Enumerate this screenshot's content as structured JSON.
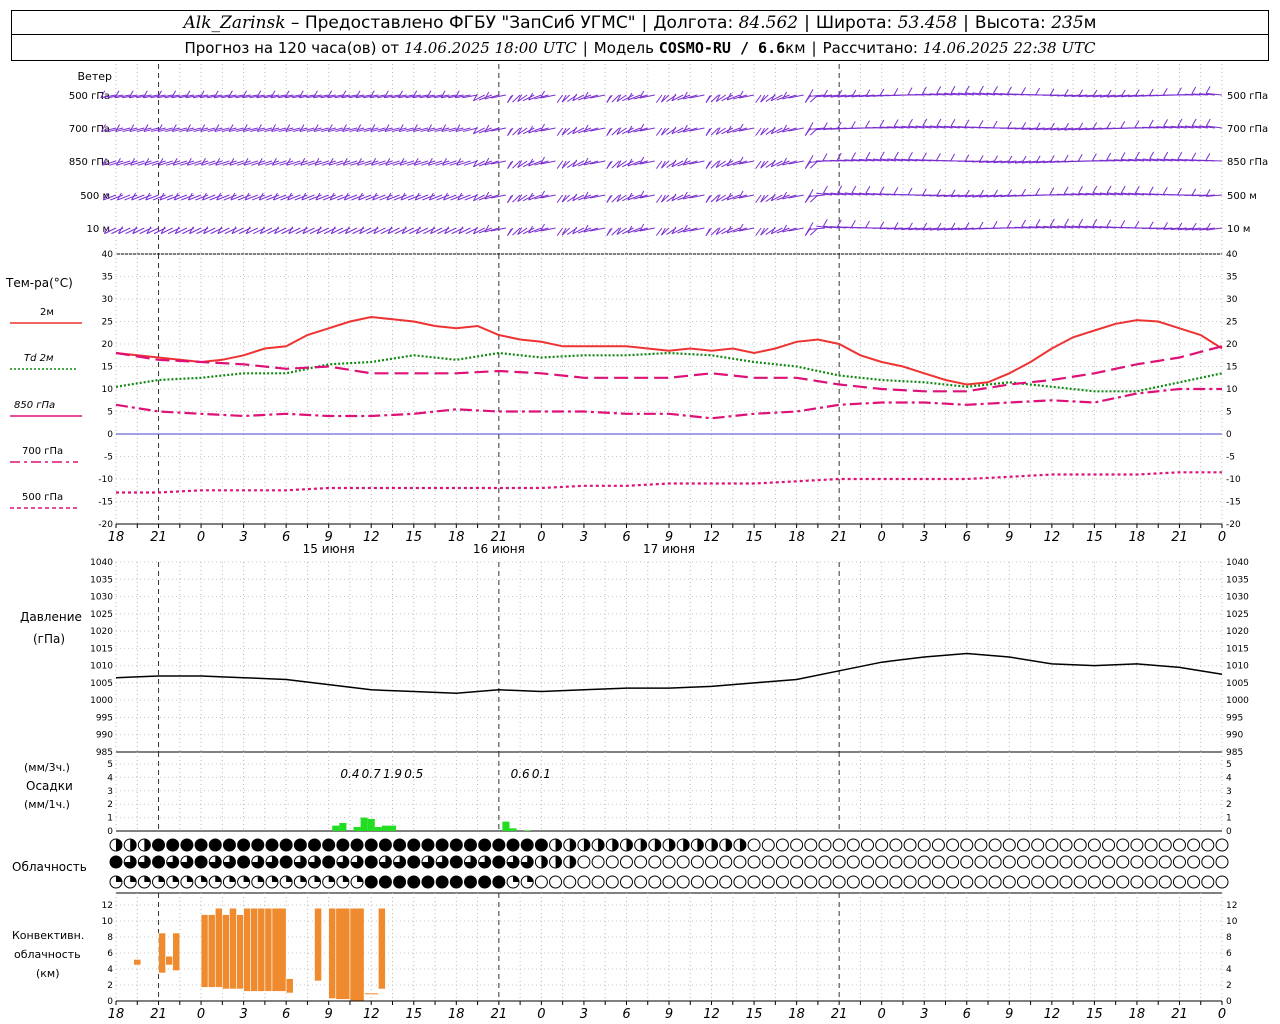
{
  "header": {
    "station": "Alk_Zarinsk",
    "provider": " – Предоставлено ФГБУ \"ЗапСиб УГМС\"",
    "lon_label": "Долгота:",
    "lon": "84.562",
    "lat_label": "Широта:",
    "lat": "53.458",
    "alt_label": "Высота:",
    "alt": "235",
    "alt_unit": "м",
    "forecast_label": "Прогноз на 120 часа(ов) от",
    "run_time": "14.06.2025 18:00 UTC",
    "model_label": "Модель",
    "model": "COSMO-RU / 6.6",
    "model_unit": "км",
    "calc_label": "Рассчитано:",
    "calc_time": "14.06.2025 22:38 UTC"
  },
  "panels": {
    "wind": {
      "title": "Ветер",
      "levels": [
        "500 гПа",
        "700 гПа",
        "850 гПа",
        "500 м",
        "10 м"
      ]
    },
    "temperature": {
      "title": "Тем-ра(°C)",
      "legend": [
        {
          "label": "2м",
          "color": "#ee3333",
          "dash": "solid"
        },
        {
          "label": "Td  2м",
          "color": "#118811",
          "dash": "dotted"
        },
        {
          "label": "850 гПа",
          "color": "#dd1177",
          "dash": "dash"
        },
        {
          "label": "700 гПа",
          "color": "#dd1177",
          "dash": "dashdot"
        },
        {
          "label": "500 гПа",
          "color": "#dd1177",
          "dash": "dot"
        }
      ],
      "ticks": [
        "40",
        "35",
        "30",
        "25",
        "20",
        "15",
        "10",
        "5",
        "0",
        "-5",
        "-10",
        "-15",
        "-20"
      ]
    },
    "pressure": {
      "title1": "Давление",
      "title2": "(гПа)",
      "ticks": [
        "1040",
        "1035",
        "1030",
        "1025",
        "1020",
        "1015",
        "1010",
        "1005",
        "1000",
        "995",
        "990",
        "985"
      ]
    },
    "precip": {
      "title1": "(мм/3ч.)",
      "title2": "Осадки",
      "title3": "(мм/1ч.)",
      "ticks": [
        "5",
        "4",
        "3",
        "2",
        "1",
        "0"
      ]
    },
    "cloud": {
      "title": "Облачность"
    },
    "convective": {
      "title1": "Конвективн.",
      "title2": "облачность",
      "title3": "(км)",
      "ticks": [
        "12",
        "10",
        "8",
        "6",
        "4",
        "2",
        "0"
      ]
    }
  },
  "time_axis": {
    "hour_labels": [
      "18",
      "21",
      "0",
      "3",
      "6",
      "9",
      "12",
      "15",
      "18",
      "21",
      "0",
      "3",
      "6",
      "9",
      "12",
      "15",
      "18",
      "21",
      "0",
      "3",
      "6",
      "9",
      "12",
      "15",
      "18",
      "21",
      "0"
    ],
    "day_labels": [
      {
        "text": "15 июня",
        "at_hour": 24
      },
      {
        "text": "16 июня",
        "at_hour": 48
      },
      {
        "text": "17 июня",
        "at_hour": 72
      }
    ]
  },
  "chart_data": [
    {
      "type": "line",
      "title": "Тем-ра(°C)",
      "x_unit": "hours from 14.06 18 UTC",
      "ylim": [
        -20,
        40
      ],
      "series": [
        {
          "name": "2м",
          "color": "#ee3333",
          "x": [
            0,
            3,
            6,
            9,
            12,
            15,
            18,
            21,
            24,
            27,
            30,
            33,
            36,
            39,
            42,
            45,
            48,
            51,
            54,
            57,
            60,
            63,
            66,
            69,
            72,
            75,
            78,
            81,
            84,
            87,
            90,
            93,
            96,
            99,
            102,
            105,
            108,
            111,
            114,
            117,
            120,
            123,
            126,
            129,
            132,
            135,
            138,
            141,
            144,
            147,
            150,
            153,
            156
          ],
          "y": [
            18,
            17.5,
            17,
            16.5,
            16,
            16.5,
            17.5,
            19,
            19.5,
            22,
            23.5,
            25,
            26,
            25.5,
            25,
            24,
            23.5,
            24,
            22,
            21,
            20.5,
            19.5,
            19.5,
            19.5,
            19.5,
            19,
            18.5,
            19,
            18.5,
            19,
            18,
            19,
            20.5,
            21,
            20,
            17.5,
            16,
            15,
            13.5,
            12,
            11,
            11.5,
            13.5,
            16,
            19,
            21.5,
            23,
            24.5,
            25.3,
            25,
            23.5,
            22,
            19
          ]
        },
        {
          "name": "Td  2м",
          "color": "#118811",
          "x": [
            0,
            6,
            12,
            18,
            24,
            30,
            36,
            42,
            48,
            54,
            60,
            66,
            72,
            78,
            84,
            90,
            96,
            102,
            108,
            114,
            120,
            126,
            132,
            138,
            144,
            150,
            156
          ],
          "y": [
            10.5,
            12,
            12.5,
            13.5,
            13.5,
            15.5,
            16,
            17.5,
            16.5,
            18,
            17,
            17.5,
            17.5,
            18,
            17.5,
            16,
            15,
            13,
            12,
            11.5,
            10.5,
            11.5,
            10.5,
            9.5,
            9.5,
            11.5,
            13.5
          ]
        },
        {
          "name": "850 гПа",
          "color": "#dd1177",
          "x": [
            0,
            6,
            12,
            18,
            24,
            30,
            36,
            42,
            48,
            54,
            60,
            66,
            72,
            78,
            84,
            90,
            96,
            102,
            108,
            114,
            120,
            126,
            132,
            138,
            144,
            150,
            156
          ],
          "y": [
            18,
            16.5,
            16,
            15.5,
            14.5,
            15,
            13.5,
            13.5,
            13.5,
            14,
            13.5,
            12.5,
            12.5,
            12.5,
            13.5,
            12.5,
            12.5,
            11,
            10,
            9.5,
            9.5,
            11,
            12,
            13.5,
            15.5,
            17,
            19.5
          ]
        },
        {
          "name": "700 гПа",
          "color": "#dd1177",
          "x": [
            0,
            6,
            12,
            18,
            24,
            30,
            36,
            42,
            48,
            54,
            60,
            66,
            72,
            78,
            84,
            90,
            96,
            102,
            108,
            114,
            120,
            126,
            132,
            138,
            144,
            150,
            156
          ],
          "y": [
            6.5,
            5,
            4.5,
            4,
            4.5,
            4,
            4,
            4.5,
            5.5,
            5,
            5,
            5,
            4.5,
            4.5,
            3.5,
            4.5,
            5,
            6.5,
            7,
            7,
            6.5,
            7,
            7.5,
            7,
            9,
            10,
            10
          ]
        },
        {
          "name": "500 гПа",
          "color": "#dd1177",
          "x": [
            0,
            6,
            12,
            18,
            24,
            30,
            36,
            42,
            48,
            54,
            60,
            66,
            72,
            78,
            84,
            90,
            96,
            102,
            108,
            114,
            120,
            126,
            132,
            138,
            144,
            150,
            156
          ],
          "y": [
            -13,
            -13,
            -12.5,
            -12.5,
            -12.5,
            -12,
            -12,
            -12,
            -12,
            -12,
            -12,
            -11.5,
            -11.5,
            -11,
            -11,
            -11,
            -10.5,
            -10,
            -10,
            -10,
            -10,
            -9.5,
            -9,
            -9,
            -9,
            -8.5,
            -8.5
          ]
        }
      ]
    },
    {
      "type": "line",
      "title": "Давление",
      "x_unit": "hours from 14.06 18 UTC",
      "ylim": [
        985,
        1040
      ],
      "series": [
        {
          "name": "",
          "color": "#000000",
          "x": [
            0,
            6,
            12,
            18,
            24,
            30,
            36,
            42,
            48,
            54,
            60,
            66,
            72,
            78,
            84,
            90,
            96,
            102,
            108,
            114,
            120,
            126,
            132,
            138,
            144,
            150,
            156
          ],
          "y": [
            1006.5,
            1007,
            1007,
            1006.5,
            1006,
            1004.5,
            1003,
            1002.5,
            1002,
            1003,
            1002.5,
            1003,
            1003.5,
            1003.5,
            1004,
            1005,
            1006,
            1008.5,
            1011,
            1012.5,
            1013.5,
            1012.5,
            1010.5,
            1010,
            1010.5,
            1009.5,
            1007.5
          ]
        }
      ]
    },
    {
      "type": "bar",
      "title": "Осадки",
      "x_unit": "hours from 14.06 18 UTC",
      "ylim": [
        0,
        5
      ],
      "labels": [
        {
          "text": "0.4",
          "at_hour": 33
        },
        {
          "text": "0.7",
          "at_hour": 36
        },
        {
          "text": "1.9",
          "at_hour": 39
        },
        {
          "text": "0.5",
          "at_hour": 42
        },
        {
          "text": "0.6",
          "at_hour": 57
        },
        {
          "text": "0.1",
          "at_hour": 60
        }
      ],
      "bars": {
        "hour": [
          31,
          32,
          34,
          35,
          36,
          37,
          38,
          39,
          40,
          55,
          56,
          58
        ],
        "value": [
          0.4,
          0.6,
          0.3,
          1.0,
          0.9,
          0.3,
          0.4,
          0.4,
          0.0,
          0.7,
          0.2,
          0.05
        ]
      }
    },
    {
      "type": "bar",
      "title": "Конвективн. облачность",
      "x_unit": "hours from 14.06 18 UTC",
      "ylim": [
        0,
        13
      ],
      "bars": {
        "hour_start": [
          2.5,
          6,
          7,
          8,
          12,
          13,
          14,
          15,
          16,
          17,
          18,
          19,
          20,
          21,
          22,
          24,
          25,
          26,
          27,
          28,
          29,
          30,
          31,
          33,
          35,
          37
        ],
        "hour_end": [
          3.5,
          7,
          8,
          9,
          13,
          14,
          15,
          16,
          17,
          18,
          19,
          20,
          21,
          22,
          24,
          25,
          26,
          27,
          28,
          29,
          30,
          31,
          33,
          35,
          37,
          38
        ],
        "base": [
          4.5,
          3.5,
          4.5,
          3.8,
          1.7,
          1.7,
          1.7,
          1.5,
          1.5,
          1.5,
          1.2,
          1.2,
          1.2,
          1.2,
          1.2,
          1.0,
          1.0,
          1.2,
          1.2,
          2.5,
          0.2,
          0.3,
          0.2,
          0.0,
          0.8,
          1.5
        ],
        "top": [
          5.2,
          8.5,
          5.6,
          8.5,
          10.8,
          10.8,
          11.6,
          10.8,
          11.6,
          10.8,
          11.6,
          11.6,
          11.6,
          11.6,
          11.6,
          2.8,
          0.5,
          0.5,
          0.3,
          11.6,
          0.0,
          11.6,
          11.6,
          11.6,
          1.0,
          11.6
        ]
      }
    }
  ]
}
